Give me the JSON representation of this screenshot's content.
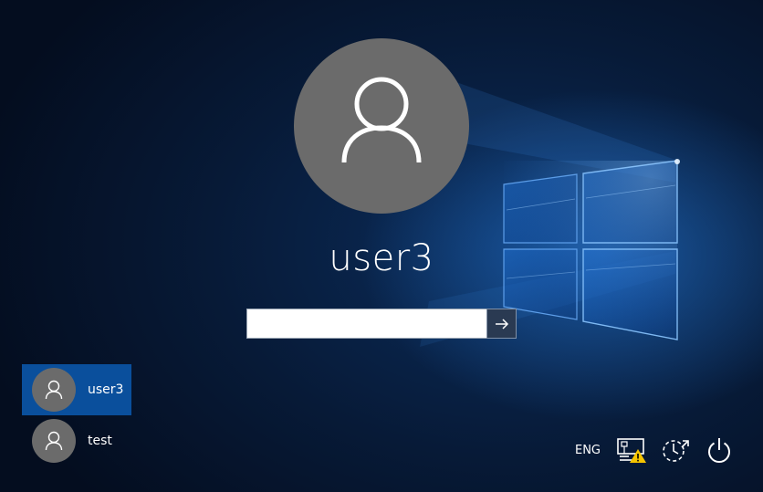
{
  "lock_screen": {
    "selected_user": "user3",
    "password": {
      "value": "",
      "placeholder": ""
    }
  },
  "user_list": [
    {
      "name": "user3",
      "selected": true
    },
    {
      "name": "test",
      "selected": false
    }
  ],
  "tray": {
    "language": "ENG",
    "icons": [
      "network-warning-icon",
      "ease-of-access-icon",
      "power-icon"
    ]
  },
  "colors": {
    "selected_user_bg": "#0a4f9c",
    "avatar_bg": "#6b6b6b",
    "warning": "#f5c400"
  }
}
